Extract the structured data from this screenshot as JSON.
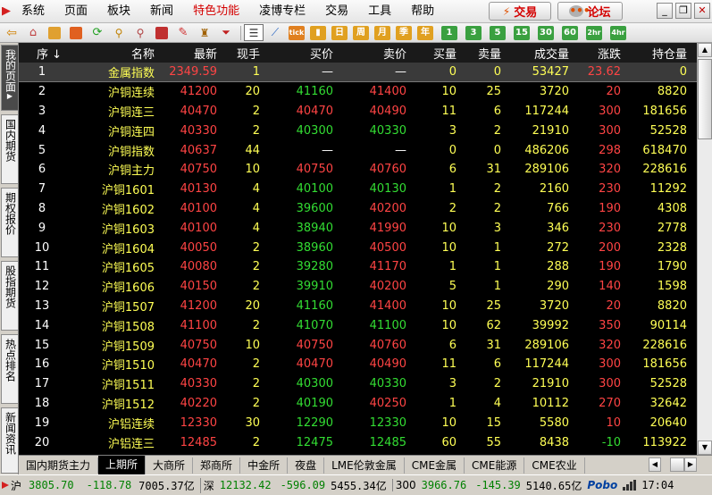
{
  "menu": {
    "items": [
      "系统",
      "页面",
      "板块",
      "新闻",
      "特色功能",
      "凌博专栏",
      "交易",
      "工具",
      "帮助"
    ],
    "special_index": 4,
    "trade_label": "交易",
    "forum_label": "论坛"
  },
  "toolbar": {
    "period_buttons": [
      "日",
      "周",
      "月",
      "季",
      "年"
    ],
    "minute_buttons": [
      "1",
      "3",
      "5",
      "15",
      "30",
      "60",
      "2hr",
      "4hr"
    ]
  },
  "left_tabs": [
    "我的页面",
    "国内期货",
    "期权报价",
    "股指期货",
    "热点排名",
    "新闻资讯"
  ],
  "table": {
    "columns": [
      "序",
      "名称",
      "最新",
      "现手",
      "买价",
      "卖价",
      "买量",
      "卖量",
      "成交量",
      "涨跌",
      "持仓量",
      "仓"
    ],
    "rows": [
      [
        "1",
        "金属指数",
        "2349.59",
        "1",
        "—",
        "—",
        "0",
        "0",
        "53427",
        "23.62",
        "0",
        ""
      ],
      [
        "2",
        "沪铜连续",
        "41200",
        "20",
        "41160",
        "41400",
        "10",
        "25",
        "3720",
        "20",
        "8820",
        "-17"
      ],
      [
        "3",
        "沪铜连三",
        "40470",
        "2",
        "40470",
        "40490",
        "11",
        "6",
        "117244",
        "300",
        "181656",
        "65"
      ],
      [
        "4",
        "沪铜连四",
        "40330",
        "2",
        "40300",
        "40330",
        "3",
        "2",
        "21910",
        "300",
        "52528",
        "10"
      ],
      [
        "5",
        "沪铜指数",
        "40637",
        "44",
        "—",
        "—",
        "0",
        "0",
        "486206",
        "298",
        "618470",
        "39"
      ],
      [
        "6",
        "沪铜主力",
        "40750",
        "10",
        "40750",
        "40760",
        "6",
        "31",
        "289106",
        "320",
        "228616",
        "-45"
      ],
      [
        "7",
        "沪铜1601",
        "40130",
        "4",
        "40100",
        "40130",
        "1",
        "2",
        "2160",
        "230",
        "11292",
        "2"
      ],
      [
        "8",
        "沪铜1602",
        "40100",
        "4",
        "39600",
        "40200",
        "2",
        "2",
        "766",
        "190",
        "4308",
        ""
      ],
      [
        "9",
        "沪铜1603",
        "40100",
        "4",
        "38940",
        "41990",
        "10",
        "3",
        "346",
        "230",
        "2778",
        ""
      ],
      [
        "10",
        "沪铜1604",
        "40050",
        "2",
        "38960",
        "40500",
        "10",
        "1",
        "272",
        "200",
        "2328",
        ""
      ],
      [
        "11",
        "沪铜1605",
        "40080",
        "2",
        "39280",
        "41170",
        "1",
        "1",
        "288",
        "190",
        "1790",
        ""
      ],
      [
        "12",
        "沪铜1606",
        "40150",
        "2",
        "39910",
        "40200",
        "5",
        "1",
        "290",
        "140",
        "1598",
        "1"
      ],
      [
        "13",
        "沪铜1507",
        "41200",
        "20",
        "41160",
        "41400",
        "10",
        "25",
        "3720",
        "20",
        "8820",
        "-17"
      ],
      [
        "14",
        "沪铜1508",
        "41100",
        "2",
        "41070",
        "41100",
        "10",
        "62",
        "39992",
        "350",
        "90114",
        "-5"
      ],
      [
        "15",
        "沪铜1509",
        "40750",
        "10",
        "40750",
        "40760",
        "6",
        "31",
        "289106",
        "320",
        "228616",
        "-45"
      ],
      [
        "16",
        "沪铜1510",
        "40470",
        "2",
        "40470",
        "40490",
        "11",
        "6",
        "117244",
        "300",
        "181656",
        "65"
      ],
      [
        "17",
        "沪铜1511",
        "40330",
        "2",
        "40300",
        "40330",
        "3",
        "2",
        "21910",
        "300",
        "52528",
        "10"
      ],
      [
        "18",
        "沪铜1512",
        "40220",
        "2",
        "40190",
        "40250",
        "1",
        "4",
        "10112",
        "270",
        "32642",
        "19"
      ],
      [
        "19",
        "沪铝连续",
        "12330",
        "30",
        "12290",
        "12330",
        "10",
        "15",
        "5580",
        "10",
        "20640",
        "-30"
      ],
      [
        "20",
        "沪铝连三",
        "12485",
        "2",
        "12475",
        "12485",
        "60",
        "55",
        "8438",
        "-10",
        "113922",
        "27"
      ]
    ]
  },
  "bottom_tabs": [
    "国内期货主力",
    "上期所",
    "大商所",
    "郑商所",
    "中金所",
    "夜盘",
    "LME伦敦金属",
    "CME金属",
    "CME能源",
    "CME农业"
  ],
  "bottom_active_index": 1,
  "status": {
    "sh_label": "沪",
    "sh_index": "3805.70",
    "sh_change": "-118.78",
    "sh_amount": "7005.37亿",
    "sz_label": "深",
    "sz_index": "12132.42",
    "sz_change": "-596.09",
    "sz_amount": "5455.34亿",
    "idx300_label": "300",
    "idx300_index": "3966.76",
    "idx300_change": "-145.39",
    "idx300_amount": "5140.65亿",
    "brand": "Pobo",
    "time": "17:04"
  }
}
